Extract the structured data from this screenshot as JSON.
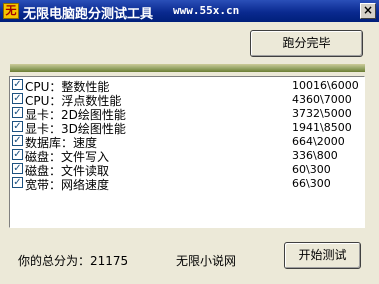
{
  "window": {
    "icon_glyph": "无",
    "title": "无限电脑跑分测试工具",
    "url": "www.55x.cn",
    "close_glyph": "×"
  },
  "buttons": {
    "complete_label": "跑分完毕",
    "start_label": "开始测试"
  },
  "tests": [
    {
      "label": "CPU：整数性能",
      "value": "10016\\6000",
      "checked": true
    },
    {
      "label": "CPU：浮点数性能",
      "value": "4360\\7000",
      "checked": true
    },
    {
      "label": "显卡：2D绘图性能",
      "value": "3732\\5000",
      "checked": true
    },
    {
      "label": "显卡：3D绘图性能",
      "value": "1941\\8500",
      "checked": true
    },
    {
      "label": "数据库：速度",
      "value": "664\\2000",
      "checked": true
    },
    {
      "label": "磁盘：文件写入",
      "value": "336\\800",
      "checked": true
    },
    {
      "label": "磁盘：文件读取",
      "value": "60\\300",
      "checked": true
    },
    {
      "label": "宽带：网络速度",
      "value": "66\\300",
      "checked": true
    }
  ],
  "footer": {
    "total_score": "你的总分为：21175",
    "site_name": "无限小说网"
  },
  "icons": {
    "checkbox": "check-icon",
    "close": "close-icon",
    "app": "app-icon"
  },
  "colors": {
    "titlebar": "#0a2a90",
    "stripe": "#9aa86a",
    "window_bg": "#ece9d8"
  }
}
